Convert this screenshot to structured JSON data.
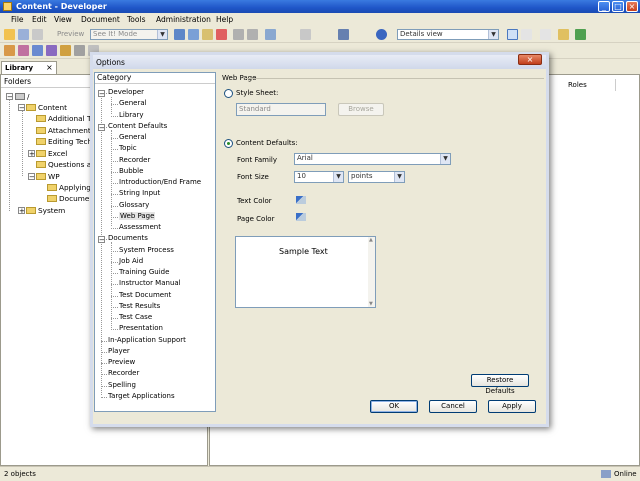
{
  "window": {
    "title": "Content - Developer"
  },
  "menu": [
    "File",
    "Edit",
    "View",
    "Document",
    "Tools",
    "Administration",
    "Help"
  ],
  "toolbar": {
    "preview_label": "Preview",
    "mode_combo": "See It! Mode",
    "view_combo": "Details view"
  },
  "library": {
    "tab_label": "Library",
    "tab_close": "×",
    "folders_header": "Folders",
    "root": "/",
    "tree": [
      {
        "label": "Content"
      },
      {
        "label": "Additional Top"
      },
      {
        "label": "Attachments"
      },
      {
        "label": "Editing Techn"
      },
      {
        "label": "Excel"
      },
      {
        "label": "Questions and"
      },
      {
        "label": "WP"
      },
      {
        "label": "Applying"
      },
      {
        "label": "Documer"
      },
      {
        "label": "System"
      }
    ]
  },
  "right_panel": {
    "roles_header": "Roles"
  },
  "status": {
    "objects": "2 objects",
    "online": "Online"
  },
  "dialog": {
    "title": "Options",
    "close": "×",
    "category_header": "Category",
    "categories": [
      "Developer",
      "General",
      "Library",
      "Content Defaults",
      "General",
      "Topic",
      "Recorder",
      "Bubble",
      "Introduction/End Frame",
      "String Input",
      "Glossary",
      "Web Page",
      "Assessment",
      "Documents",
      "System Process",
      "Job Aid",
      "Training Guide",
      "Instructor Manual",
      "Test Document",
      "Test Results",
      "Test Case",
      "Presentation",
      "In-Application Support",
      "Player",
      "Preview",
      "Recorder",
      "Spelling",
      "Target Applications"
    ],
    "selected_category": "Web Page",
    "section_title": "Web Page",
    "style_sheet_label": "Style Sheet:",
    "style_sheet_value": "Standard",
    "browse_label": "Browse",
    "content_defaults_label": "Content Defaults:",
    "font_family_label": "Font Family",
    "font_family_value": "Arial",
    "font_size_label": "Font Size",
    "font_size_value": "10",
    "font_unit_value": "points",
    "text_color_label": "Text Color",
    "page_color_label": "Page Color",
    "sample_text": "Sample Text",
    "restore_label": "Restore Defaults",
    "ok_label": "OK",
    "cancel_label": "Cancel",
    "apply_label": "Apply"
  },
  "colors": {
    "title_blue": "#1f56c8",
    "dialog_bg": "#ece9d8",
    "selection": "#e4e4e4"
  }
}
